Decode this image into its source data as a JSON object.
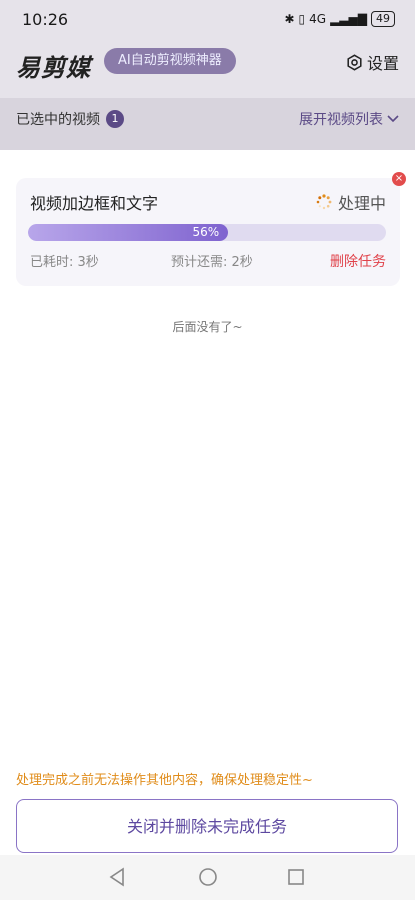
{
  "status": {
    "time": "10:26",
    "network": "4G",
    "battery": "49"
  },
  "header": {
    "logo": "易剪媒",
    "tagline": "AI自动剪视频神器",
    "settings_label": "设置"
  },
  "selection": {
    "label": "已选中的视频",
    "count": "1",
    "expand_label": "展开视频列表"
  },
  "task": {
    "title": "视频加边框和文字",
    "status": "处理中",
    "progress": 56,
    "progress_label": "56%",
    "elapsed": "已耗时: 3秒",
    "remaining": "预计还需: 2秒",
    "delete_label": "删除任务",
    "close_symbol": "×"
  },
  "list_end_text": "后面没有了~",
  "warning_text": "处理完成之前无法操作其他内容，确保处理稳定性~",
  "close_delete_button": "关闭并删除未完成任务",
  "colors": {
    "accent": "#5d48a0",
    "progress_start": "#b8a6ea",
    "progress_end": "#7f63cf",
    "danger": "#e0424a",
    "warning": "#e08c1a"
  }
}
